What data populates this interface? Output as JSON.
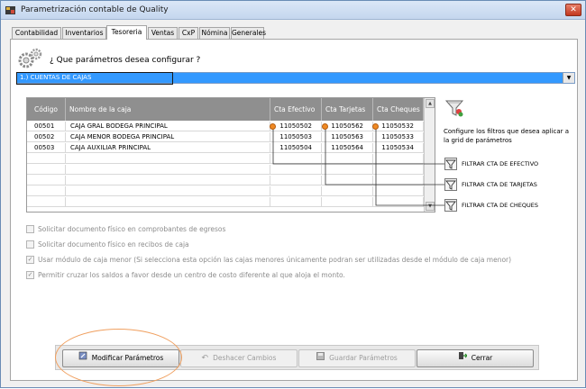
{
  "window": {
    "title": "Parametrización contable de Quality",
    "close_label": "✕"
  },
  "tabs": [
    {
      "label": "Contabilidad"
    },
    {
      "label": "Inventarios"
    },
    {
      "label": "Tesoreria",
      "active": true
    },
    {
      "label": "Ventas"
    },
    {
      "label": "CxP"
    },
    {
      "label": "Nómina"
    },
    {
      "label": "Generales"
    }
  ],
  "question": "¿ Que parámetros desea configurar ?",
  "dropdown": {
    "selected": "1.) CUENTAS DE CAJAS"
  },
  "grid": {
    "headers": [
      "Código",
      "Nombre de la caja",
      "Cta Efectivo",
      "Cta Tarjetas",
      "Cta Cheques"
    ],
    "rows": [
      [
        "00501",
        "CAJA GRAL BODEGA PRINCIPAL",
        "11050502",
        "11050562",
        "11050532"
      ],
      [
        "00502",
        "CAJA MENOR BODEGA PRINCIPAL",
        "11050503",
        "11050563",
        "11050533"
      ],
      [
        "00503",
        "CAJA AUXILIAR PRINCIPAL",
        "11050504",
        "11050564",
        "11050534"
      ]
    ]
  },
  "filters": {
    "help_text": "Configure los filtros que desea aplicar a la grid de parámetros",
    "items": [
      {
        "label": "FILTRAR CTA DE EFECTIVO"
      },
      {
        "label": "FILTRAR CTA DE TARJETAS"
      },
      {
        "label": "FILTRAR CTA DE CHEQUES"
      }
    ]
  },
  "options": [
    {
      "label": "Solicitar documento físico en comprobantes de egresos",
      "checked": false
    },
    {
      "label": "Solicitar documento físico en recibos de caja",
      "checked": false
    },
    {
      "label": "Usar módulo de caja menor (Si selecciona esta opción las cajas menores únicamente podran ser utilizadas desde el módulo de caja menor)",
      "checked": true
    },
    {
      "label": "Permitir cruzar los saldos a favor desde un centro de costo diferente al que aloja el monto.",
      "checked": true
    }
  ],
  "buttons": {
    "modify": "Modificar Parámetros",
    "undo": "Deshacer Cambios",
    "save": "Guardar Parámetros",
    "close": "Cerrar"
  },
  "colors": {
    "selection": "#3399ff",
    "marker": "#f08a24",
    "header": "#8f8f8f"
  }
}
